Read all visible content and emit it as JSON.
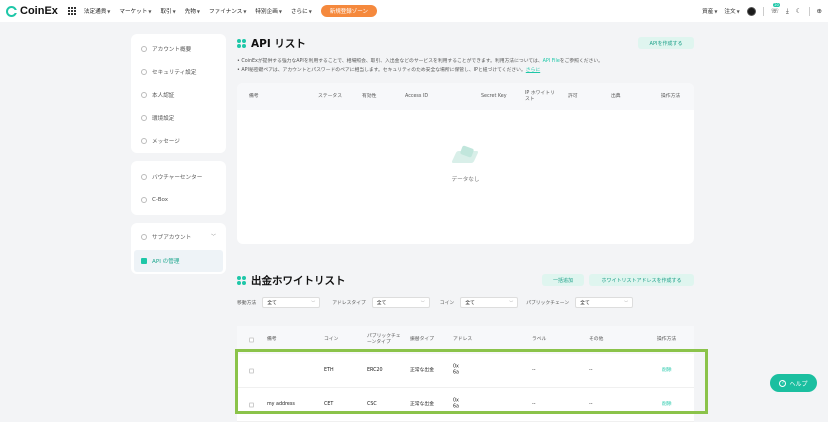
{
  "brand": {
    "name": "CoinEx"
  },
  "nav": {
    "items": [
      "法定通貨",
      "マーケット",
      "取引",
      "先物",
      "ファイナンス",
      "特別企画",
      "さらに"
    ],
    "promo": "新規登録ゾーン",
    "right": {
      "assets": "資産",
      "orders": "注文",
      "badge": "20"
    }
  },
  "sidebar": {
    "group1": [
      "アカウント概要",
      "セキュリティ設定",
      "本人認証",
      "環境設定",
      "メッセージ"
    ],
    "group2": [
      "バウチャーセンター",
      "C-Box"
    ],
    "group3": [
      "サブアカウント",
      "API の管理"
    ]
  },
  "api": {
    "title": "API リスト",
    "create_button": "APIを作成する",
    "desc1_a": "• CoinExが提供する強力なAPIを利用することで、相場照会、取引、入出金などのサービスを利用することができます。利用方法については、",
    "desc1_link": "API File",
    "desc1_b": "をご参照ください。",
    "desc2_a": "• API秘密鍵ペアは、アカウントとパスワードのペアに相当します。セキュリティのため安全な場所に保管し、IPと紐づけてください。",
    "desc2_link": "さらに",
    "columns": [
      "備考",
      "ステータス",
      "有効性",
      "Access ID",
      "Secret Key",
      "IP ホワイトリスト",
      "許可",
      "出典",
      "操作方法"
    ],
    "empty": "データなし"
  },
  "whitelist": {
    "title": "出金ホワイトリスト",
    "bulk_button": "一括追加",
    "create_button": "ホワイトリストアドレスを作成する",
    "filters": [
      {
        "label": "移動方法",
        "value": "全て"
      },
      {
        "label": "アドレスタイプ",
        "value": "全て"
      },
      {
        "label": "コイン",
        "value": "全て"
      },
      {
        "label": "パブリックチェーン",
        "value": "全て"
      }
    ],
    "columns": [
      "備考",
      "コイン",
      "パブリックチェーンタイプ",
      "振替タイプ",
      "アドレス",
      "ラベル",
      "その他",
      "操作方法"
    ],
    "rows": [
      {
        "memo": "",
        "coin": "ETH",
        "chain": "ERC20",
        "type": "正常な出金",
        "address": "0x\n6a",
        "label": "--",
        "other": "--",
        "action": "削除"
      },
      {
        "memo": "my address",
        "coin": "CET",
        "chain": "CSC",
        "type": "正常な出金",
        "address": "0x\n6a",
        "label": "--",
        "other": "--",
        "action": "削除"
      }
    ]
  },
  "help": {
    "label": "ヘルプ"
  },
  "colors": {
    "accent": "#1ec7a8",
    "promo": "#f5893d",
    "highlight": "#8bc34a"
  }
}
